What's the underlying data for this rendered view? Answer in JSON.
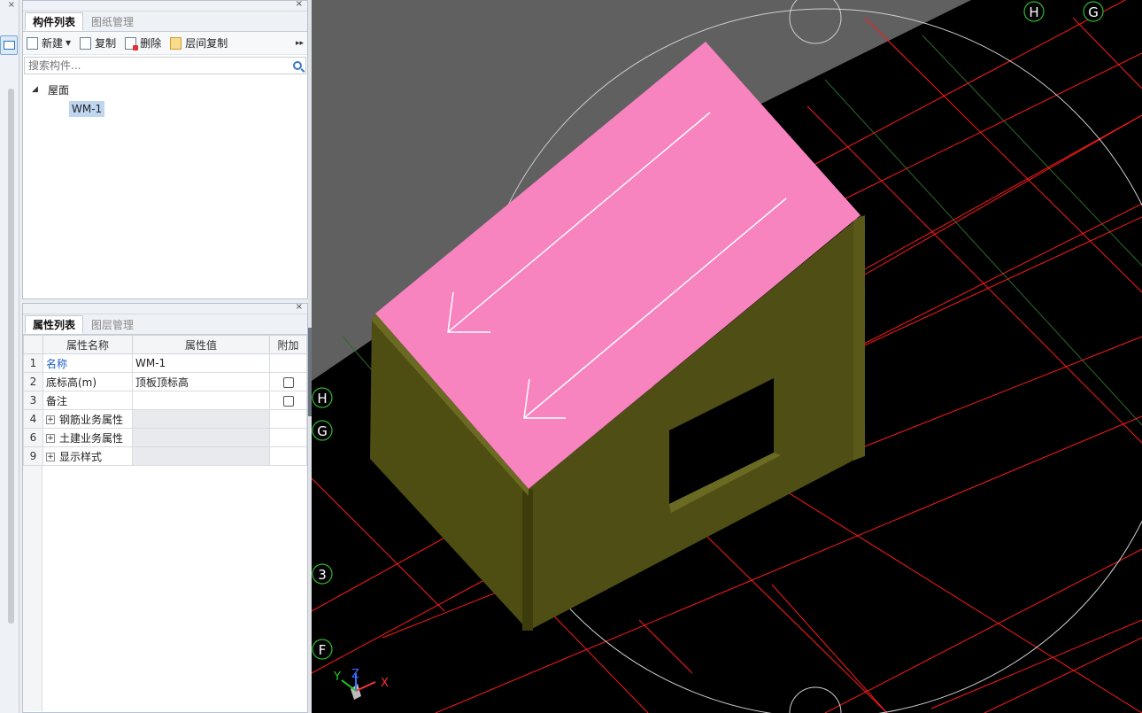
{
  "component_panel": {
    "tabs": [
      "构件列表",
      "图纸管理"
    ],
    "toolbar": {
      "new": "新建",
      "copy": "复制",
      "delete": "删除",
      "floor_copy": "层间复制"
    },
    "search_placeholder": "搜索构件...",
    "tree": {
      "category": "屋面",
      "item": "WM-1"
    }
  },
  "property_panel": {
    "tabs": [
      "属性列表",
      "图层管理"
    ],
    "headers": [
      "属性名称",
      "属性值",
      "附加"
    ],
    "rows": [
      {
        "num": "1",
        "name": "名称",
        "value": "WM-1",
        "checkbox": false,
        "expand": false
      },
      {
        "num": "2",
        "name": "底标高(m)",
        "value": "顶板顶标高",
        "checkbox": true,
        "expand": false
      },
      {
        "num": "3",
        "name": "备注",
        "value": "",
        "checkbox": true,
        "expand": false
      },
      {
        "num": "4",
        "name": "钢筋业务属性",
        "value": "",
        "checkbox": false,
        "expand": true
      },
      {
        "num": "6",
        "name": "土建业务属性",
        "value": "",
        "checkbox": false,
        "expand": true
      },
      {
        "num": "9",
        "name": "显示样式",
        "value": "",
        "checkbox": false,
        "expand": true
      }
    ]
  },
  "viewport": {
    "axis_labels": {
      "top_h": "H",
      "top_g": "G",
      "left_h": "H",
      "left_g": "G",
      "left_3": "3",
      "left_f": "F"
    },
    "gizmo": {
      "x": "X",
      "y": "Y",
      "z": "Z"
    },
    "colors": {
      "roof": "#f783bf",
      "wall": "#4e4d12",
      "grid": "#ff1a1a",
      "axis_circle": "#2fb82f"
    }
  }
}
